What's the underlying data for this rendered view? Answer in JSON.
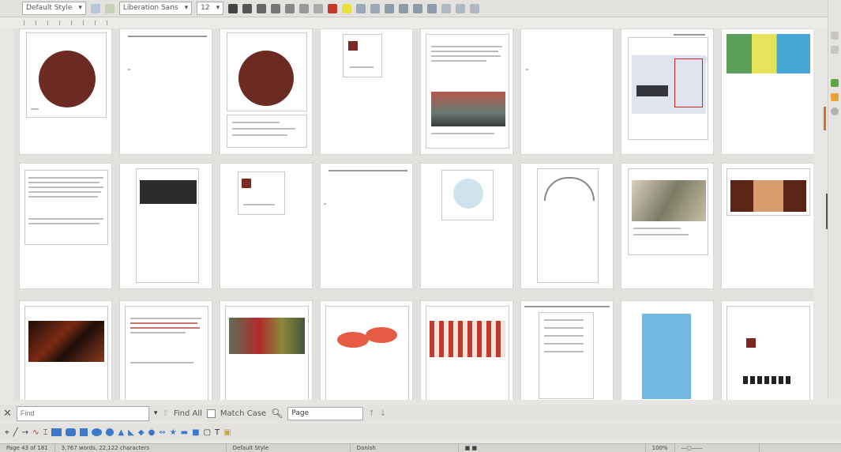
{
  "toolbar": {
    "paragraph_style": "Default Style",
    "font_name": "Liberation Sans",
    "font_size": "12"
  },
  "find": {
    "placeholder": "Find",
    "find_all_label": "Find All",
    "match_case_label": "Match Case",
    "search_scope": "Page"
  },
  "status": {
    "page_info": "Page 43 of 181",
    "word_count": "3,767 words, 22,122 characters",
    "page_style": "Default Style",
    "language": "Danish",
    "zoom": "100%"
  },
  "colors": {
    "accent": "#e06a2c",
    "photo_dark": "#6b2a22",
    "facebook_blue": "#3b5998"
  },
  "icons": {
    "find_close": "close-icon",
    "find_next": "arrow-down-icon",
    "find_prev": "arrow-up-icon",
    "find_replace": "binoculars-icon"
  }
}
